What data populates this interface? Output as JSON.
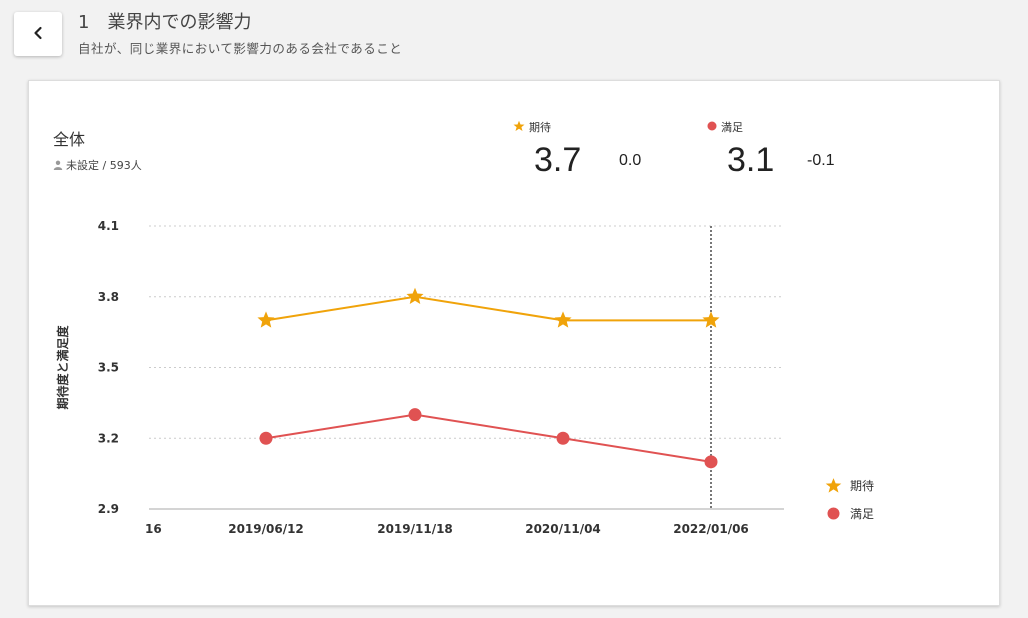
{
  "header": {
    "title": "1　業界内での影響力",
    "subtitle": "自社が、同じ業界において影響力のある会社であること"
  },
  "summary": {
    "group_name": "全体",
    "group_meta": "未設定 / 593人",
    "expectation": {
      "label": "期待",
      "value": "3.7",
      "delta": "0.0"
    },
    "satisfaction": {
      "label": "満足",
      "value": "3.1",
      "delta": "-0.1"
    }
  },
  "colors": {
    "expectation": "#f0a30a",
    "satisfaction": "#e05252",
    "grid": "#cccccc",
    "cursor": "#777777"
  },
  "chart_data": {
    "type": "line",
    "ylabel": "期待度と満足度",
    "ylim": [
      2.9,
      4.1
    ],
    "yticks": [
      "4.1",
      "3.8",
      "3.5",
      "3.2",
      "2.9"
    ],
    "ytick_values": [
      4.1,
      3.8,
      3.5,
      3.2,
      2.9
    ],
    "x_leading_partial_label": "16",
    "categories": [
      "2019/06/12",
      "2019/11/18",
      "2020/11/04",
      "2022/01/06"
    ],
    "series": [
      {
        "name": "期待",
        "marker": "star",
        "values": [
          3.7,
          3.8,
          3.7,
          3.7
        ]
      },
      {
        "name": "満足",
        "marker": "circle",
        "values": [
          3.2,
          3.3,
          3.2,
          3.1
        ]
      }
    ],
    "highlight_category_index": 3,
    "grid": true,
    "legend_position": "right"
  },
  "legend": {
    "items": [
      "期待",
      "満足"
    ]
  }
}
